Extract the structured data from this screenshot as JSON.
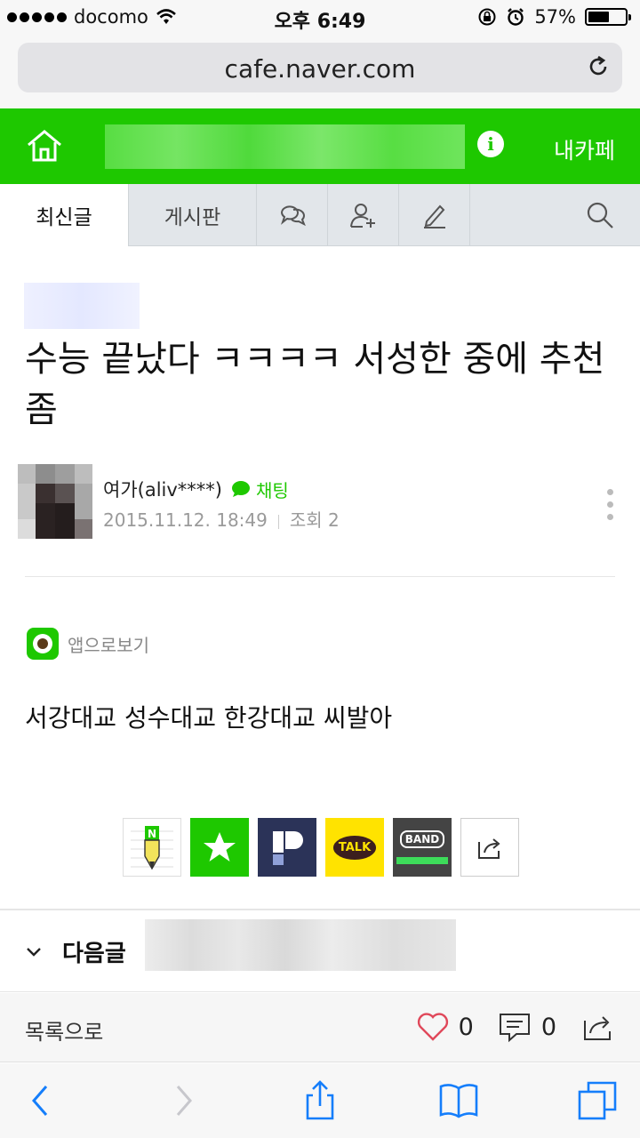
{
  "status_bar": {
    "carrier": "docomo",
    "time": "오후 6:49",
    "battery_label": "57%",
    "battery_level": 0.57
  },
  "browser": {
    "url": "cafe.naver.com"
  },
  "cafe_header": {
    "my_cafe_label": "내카페"
  },
  "tabs": [
    {
      "label": "최신글",
      "active": true
    },
    {
      "label": "게시판",
      "active": false
    },
    {
      "icon": "chat-bubbles-icon"
    },
    {
      "icon": "add-member-icon"
    },
    {
      "icon": "pencil-icon"
    },
    {
      "icon": "search-icon"
    }
  ],
  "article": {
    "title": "수능 끝났다 ㅋㅋㅋㅋ 서성한 중에 추천좀",
    "author": "여가(aliv****)",
    "chat_label": "채팅",
    "date": "2015.11.12. 18:49",
    "views": "조회 2",
    "app_view_label": "앱으로보기",
    "body": "서강대교 성수대교 한강대교 씨발아"
  },
  "share_icons": [
    "naver-blog-icon",
    "bookmark-star-icon",
    "pholar-icon",
    "kakao-talk-icon",
    "band-icon",
    "share-more-icon"
  ],
  "share_labels": {
    "talk": "TALK",
    "band": "BAND"
  },
  "next_post": {
    "label": "다음글"
  },
  "list_bar": {
    "label": "목록으로",
    "likes": "0",
    "comments": "0"
  },
  "colors": {
    "naver_green": "#1ec800",
    "safari_blue": "#157efb"
  }
}
